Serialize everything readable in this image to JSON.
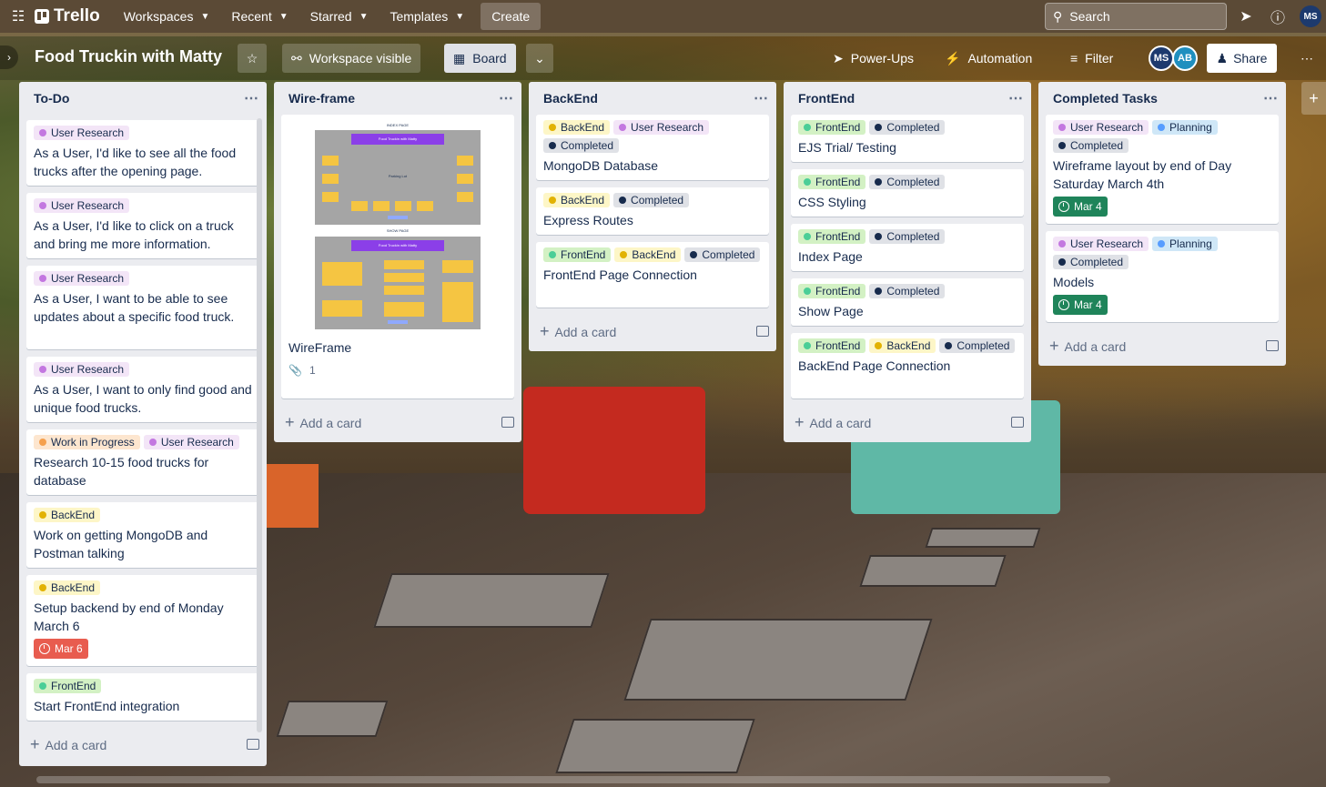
{
  "topbar": {
    "brand": "Trello",
    "menus": [
      "Workspaces",
      "Recent",
      "Starred",
      "Templates"
    ],
    "create": "Create",
    "search_placeholder": "Search",
    "avatar": "MS"
  },
  "board": {
    "title": "Food Truckin with Matty",
    "visibility": "Workspace visible",
    "view": "Board",
    "powerups": "Power-Ups",
    "automation": "Automation",
    "filter": "Filter",
    "members": [
      "MS",
      "AB"
    ],
    "share": "Share"
  },
  "lists": [
    {
      "title": "To-Do",
      "add": "Add a card",
      "cards": [
        {
          "labels": [
            {
              "text": "User Research",
              "color": "purple"
            }
          ],
          "title": "As a User, I'd like to see all the food trucks after the opening page."
        },
        {
          "labels": [
            {
              "text": "User Research",
              "color": "purple"
            }
          ],
          "title": "As a User, I'd like to click on a truck and bring me more information."
        },
        {
          "labels": [
            {
              "text": "User Research",
              "color": "purple"
            }
          ],
          "title": "As a User, I want to be able to see updates about a specific food truck."
        },
        {
          "labels": [
            {
              "text": "User Research",
              "color": "purple"
            }
          ],
          "title": "As a User, I want to only find good and unique food trucks."
        },
        {
          "labels": [
            {
              "text": "Work in Progress",
              "color": "orange"
            },
            {
              "text": "User Research",
              "color": "purple"
            }
          ],
          "title": "Research 10-15 food trucks for database"
        },
        {
          "labels": [
            {
              "text": "BackEnd",
              "color": "yellow"
            }
          ],
          "title": "Work on getting MongoDB and Postman talking"
        },
        {
          "labels": [
            {
              "text": "BackEnd",
              "color": "yellow"
            }
          ],
          "title": "Setup backend by end of Monday March 6",
          "due": "Mar 6",
          "due_color": "red"
        },
        {
          "labels": [
            {
              "text": "FrontEnd",
              "color": "green"
            }
          ],
          "title": "Start FrontEnd integration"
        }
      ]
    },
    {
      "title": "Wire-frame",
      "add": "Add a card",
      "cards": [
        {
          "title": "WireFrame",
          "attachments": "1",
          "image": {
            "top_caption": "INDEX PAGE",
            "top_bar": "Food Truckin with Matty",
            "center": "Parking Lot",
            "bottom_caption": "SHOW PAGE",
            "bottom_bar": "Food Truckin with Matty"
          }
        }
      ]
    },
    {
      "title": "BackEnd",
      "add": "Add a card",
      "cards": [
        {
          "labels": [
            {
              "text": "BackEnd",
              "color": "yellow"
            },
            {
              "text": "User Research",
              "color": "purple"
            },
            {
              "text": "Completed",
              "color": "black"
            }
          ],
          "title": "MongoDB Database"
        },
        {
          "labels": [
            {
              "text": "BackEnd",
              "color": "yellow"
            },
            {
              "text": "Completed",
              "color": "black"
            }
          ],
          "title": "Express Routes"
        },
        {
          "labels": [
            {
              "text": "FrontEnd",
              "color": "green"
            },
            {
              "text": "BackEnd",
              "color": "yellow"
            },
            {
              "text": "Completed",
              "color": "black"
            }
          ],
          "title": "FrontEnd Page Connection"
        }
      ]
    },
    {
      "title": "FrontEnd",
      "add": "Add a card",
      "cards": [
        {
          "labels": [
            {
              "text": "FrontEnd",
              "color": "green"
            },
            {
              "text": "Completed",
              "color": "black"
            }
          ],
          "title": "EJS Trial/ Testing"
        },
        {
          "labels": [
            {
              "text": "FrontEnd",
              "color": "green"
            },
            {
              "text": "Completed",
              "color": "black"
            }
          ],
          "title": "CSS Styling"
        },
        {
          "labels": [
            {
              "text": "FrontEnd",
              "color": "green"
            },
            {
              "text": "Completed",
              "color": "black"
            }
          ],
          "title": "Index Page"
        },
        {
          "labels": [
            {
              "text": "FrontEnd",
              "color": "green"
            },
            {
              "text": "Completed",
              "color": "black"
            }
          ],
          "title": "Show Page"
        },
        {
          "labels": [
            {
              "text": "FrontEnd",
              "color": "green"
            },
            {
              "text": "BackEnd",
              "color": "yellow"
            },
            {
              "text": "Completed",
              "color": "black"
            }
          ],
          "title": "BackEnd Page Connection"
        }
      ]
    },
    {
      "title": "Completed Tasks",
      "add": "Add a card",
      "cards": [
        {
          "labels": [
            {
              "text": "User Research",
              "color": "purple"
            },
            {
              "text": "Planning",
              "color": "blue"
            },
            {
              "text": "Completed",
              "color": "black"
            }
          ],
          "title": "Wireframe layout by end of Day Saturday March 4th",
          "due": "Mar 4",
          "due_color": "green"
        },
        {
          "labels": [
            {
              "text": "User Research",
              "color": "purple"
            },
            {
              "text": "Planning",
              "color": "blue"
            },
            {
              "text": "Completed",
              "color": "black"
            }
          ],
          "title": "Models",
          "due": "Mar 4",
          "due_color": "green"
        }
      ]
    }
  ]
}
